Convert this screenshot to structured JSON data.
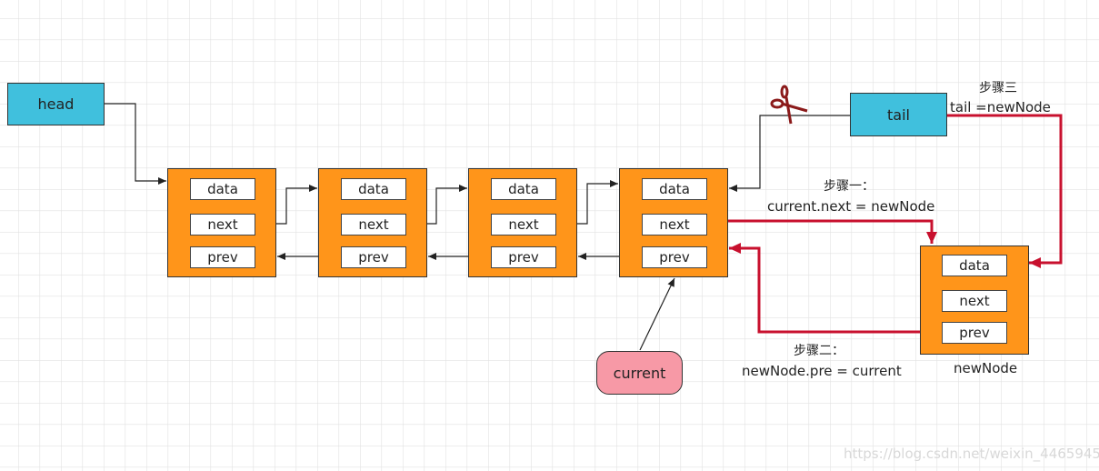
{
  "colors": {
    "pointer_box": "#40C0DD",
    "node": "#FF951A",
    "current": "#F799A6",
    "new_link": "#C8102E",
    "link": "#222222",
    "grid": "#e2e2e2"
  },
  "head": {
    "label": "head"
  },
  "tail": {
    "label": "tail"
  },
  "current": {
    "label": "current"
  },
  "nodes": [
    {
      "fields": [
        "data",
        "next",
        "prev"
      ]
    },
    {
      "fields": [
        "data",
        "next",
        "prev"
      ]
    },
    {
      "fields": [
        "data",
        "next",
        "prev"
      ]
    },
    {
      "fields": [
        "data",
        "next",
        "prev"
      ]
    }
  ],
  "new_node": {
    "fields": [
      "data",
      "next",
      "prev"
    ],
    "caption": "newNode"
  },
  "steps": {
    "step1": {
      "title": "步骤一：",
      "code": "current.next = newNode"
    },
    "step2": {
      "title": "步骤二：",
      "code": "newNode.pre = current"
    },
    "step3": {
      "title": "步骤三",
      "code": "tail =newNode"
    }
  },
  "icons": {
    "cut": "scissors-icon"
  },
  "watermark": "https://blog.csdn.net/weixin_44659458"
}
